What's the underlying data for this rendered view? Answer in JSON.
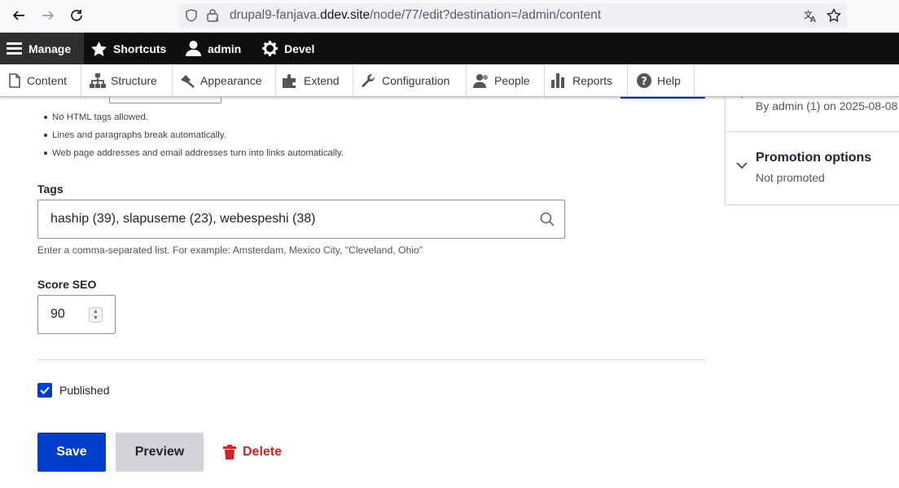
{
  "browser": {
    "url_prefix": "drupal9-fanjava.",
    "url_domain": "ddev.site",
    "url_path": "/node/77/edit?destination=/admin/content"
  },
  "toolbar": {
    "manage": "Manage",
    "shortcuts": "Shortcuts",
    "user": "admin",
    "devel": "Devel"
  },
  "tray": {
    "items": [
      {
        "label": "Content",
        "icon": "content-icon"
      },
      {
        "label": "Structure",
        "icon": "structure-icon"
      },
      {
        "label": "Appearance",
        "icon": "appearance-icon"
      },
      {
        "label": "Extend",
        "icon": "extend-icon"
      },
      {
        "label": "Configuration",
        "icon": "configuration-icon"
      },
      {
        "label": "People",
        "icon": "people-icon"
      },
      {
        "label": "Reports",
        "icon": "reports-icon"
      },
      {
        "label": "Help",
        "icon": "help-icon"
      }
    ]
  },
  "body_field": {
    "format_tips": [
      "No HTML tags allowed.",
      "Lines and paragraphs break automatically.",
      "Web page addresses and email addresses turn into links automatically."
    ]
  },
  "tags": {
    "label": "Tags",
    "value": "haship (39), slapuseme (23), webespeshi (38)",
    "description": "Enter a comma-separated list. For example: Amsterdam, Mexico City, \"Cleveland, Ohio\""
  },
  "score_seo": {
    "label": "Score SEO",
    "value": "90"
  },
  "published": {
    "label": "Published",
    "checked": true
  },
  "actions": {
    "save": "Save",
    "preview": "Preview",
    "delete": "Delete"
  },
  "sidebar": {
    "author_info": "By admin (1) on 2025-08-08",
    "promotion_title": "Promotion options",
    "promotion_summary": "Not promoted"
  },
  "colors": {
    "primary": "#003ecc",
    "danger": "#d72222",
    "toolbar_bg": "#0f0f0f"
  }
}
